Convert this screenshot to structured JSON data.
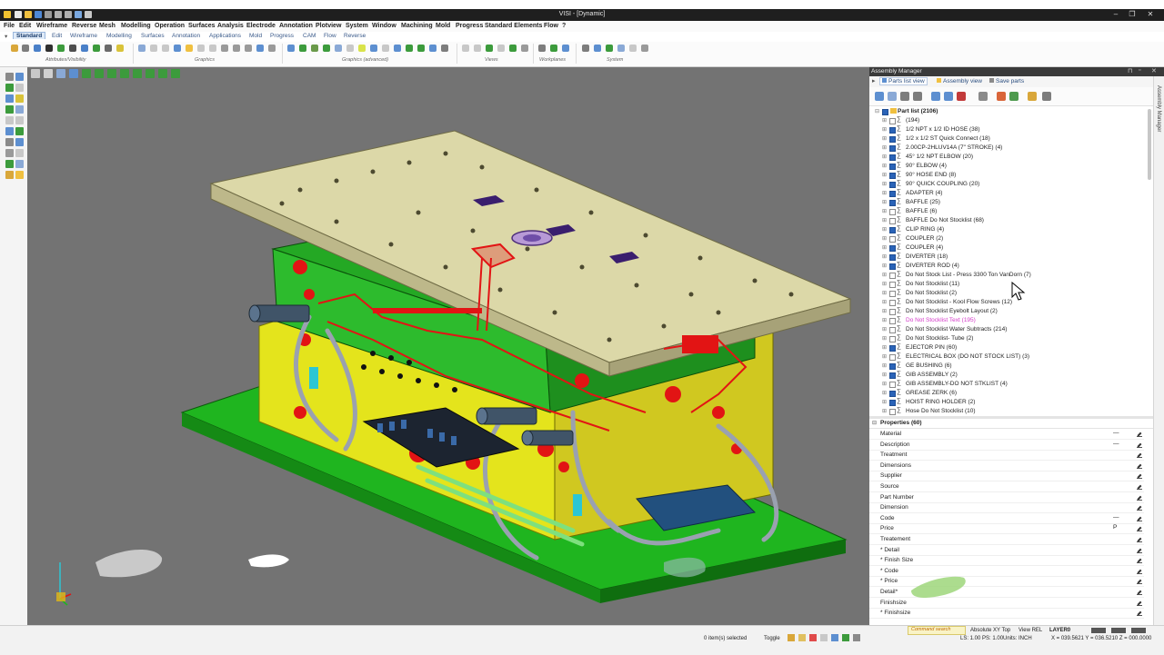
{
  "window": {
    "title": "VISI - [Dynamic]",
    "controls": [
      "–",
      "❐",
      "✕"
    ]
  },
  "menu": {
    "items": [
      "File",
      "Edit",
      "Wireframe",
      "Reverse",
      "Mesh",
      "Modelling",
      "Operation",
      "Surfaces",
      "Analysis",
      "Electrode",
      "Annotation",
      "Plotview",
      "System",
      "Window",
      "Machining",
      "Mold",
      "Progress",
      "Standard Elements",
      "Flow",
      "?"
    ]
  },
  "ribbon": {
    "tabs": [
      "Standard",
      "Edit",
      "Wireframe",
      "Modelling",
      "Surfaces",
      "Annotation",
      "Applications",
      "Mold",
      "Progress",
      "CAM",
      "Flow",
      "Reverse"
    ],
    "active_tab": "Standard",
    "groups": [
      "Attributes/Visibility",
      "Graphics",
      "Graphics (advanced)",
      "Views",
      "Workplanes",
      "System"
    ]
  },
  "assembly_manager": {
    "title": "Assembly Manager",
    "side_label": "Assembly Manager",
    "tabs": [
      "Parts list view",
      "Assembly view",
      "Save parts"
    ],
    "active_tab": "Parts list view",
    "tree_root": "Part list (2106)",
    "parts": [
      {
        "label": "(194)",
        "checked": false
      },
      {
        "label": "1/2 NPT x 1/2 ID HOSE (38)",
        "checked": true
      },
      {
        "label": "1/2 x 1/2 ST Quick Connect (18)",
        "checked": true
      },
      {
        "label": "2.00CP-2HLUV14A (7\" STROKE) (4)",
        "checked": true
      },
      {
        "label": "45° 1/2 NPT ELBOW (20)",
        "checked": true
      },
      {
        "label": "90° ELBOW (4)",
        "checked": true
      },
      {
        "label": "90° HOSE END (8)",
        "checked": true
      },
      {
        "label": "90° QUICK COUPLING (20)",
        "checked": true
      },
      {
        "label": "ADAPTER (4)",
        "checked": true
      },
      {
        "label": "BAFFLE (25)",
        "checked": true
      },
      {
        "label": "BAFFLE (6)",
        "checked": false
      },
      {
        "label": "BAFFLE Do Not Stocklist (68)",
        "checked": false
      },
      {
        "label": "CLIP RING (4)",
        "checked": true
      },
      {
        "label": "COUPLER (2)",
        "checked": false
      },
      {
        "label": "COUPLER (4)",
        "checked": true
      },
      {
        "label": "DIVERTER (18)",
        "checked": true
      },
      {
        "label": "DIVERTER ROD (4)",
        "checked": true
      },
      {
        "label": "Do Not Stock List - Press 3300 Ton VanDorn (7)",
        "checked": false
      },
      {
        "label": "Do Not Stocklist (11)",
        "checked": false
      },
      {
        "label": "Do Not Stocklist (2)",
        "checked": false
      },
      {
        "label": "Do Not Stocklist - Kool Flow Screws (12)",
        "checked": false
      },
      {
        "label": "Do Not Stocklist Eyebolt Layout (2)",
        "checked": false
      },
      {
        "label": "Do Not Stocklist Text (195)",
        "checked": false,
        "highlight": true
      },
      {
        "label": "Do Not Stocklist Water Subtracts (214)",
        "checked": false
      },
      {
        "label": "Do Not Stocklist- Tube (2)",
        "checked": false
      },
      {
        "label": "EJECTOR PIN (60)",
        "checked": true
      },
      {
        "label": "ELECTRICAL BOX (DO NOT STOCK LIST) (3)",
        "checked": false
      },
      {
        "label": "GE BUSHING (6)",
        "checked": true
      },
      {
        "label": "GIB ASSEMBLY (2)",
        "checked": true
      },
      {
        "label": "GIB ASSEMBLY-DO NOT STKLIST (4)",
        "checked": false
      },
      {
        "label": "GREASE ZERK (6)",
        "checked": true
      },
      {
        "label": "HOIST RING HOLDER (2)",
        "checked": true
      },
      {
        "label": "Hose Do Not Stocklist (10)",
        "checked": false
      }
    ],
    "properties_title": "Properties (60)",
    "properties": [
      {
        "label": "Material",
        "value": "—"
      },
      {
        "label": "Description",
        "value": "—"
      },
      {
        "label": "Treatment",
        "value": ""
      },
      {
        "label": "Dimensions",
        "value": ""
      },
      {
        "label": "Supplier",
        "value": ""
      },
      {
        "label": "Source",
        "value": ""
      },
      {
        "label": "Part Number",
        "value": ""
      },
      {
        "label": "Dimension",
        "value": ""
      },
      {
        "label": "Code",
        "value": "—"
      },
      {
        "label": "Price",
        "value": "P"
      },
      {
        "label": "Treatement",
        "value": ""
      },
      {
        "label": "* Detail",
        "value": ""
      },
      {
        "label": "* Finish Size",
        "value": ""
      },
      {
        "label": "* Code",
        "value": ""
      },
      {
        "label": "* Price",
        "value": ""
      },
      {
        "label": "Detail*",
        "value": ""
      },
      {
        "label": "Finishsize",
        "value": ""
      },
      {
        "label": "* Finishsize",
        "value": ""
      }
    ]
  },
  "status": {
    "command_search": "Command search",
    "selected": "0 item(s) selected",
    "toggle": "Toggle",
    "view": "Absolute XY Top",
    "view_rel": "View REL",
    "layer": "LAYER0",
    "ls": "LS: 1.00 PS: 1.00",
    "units": "Units: INCH",
    "coords": "X = 039.5621 Y = 036.5210 Z = 000.0000"
  },
  "colors": {
    "viewport_bg": "#737373",
    "plate_top": "#dcd8a8",
    "plate_green": "#1fb51f",
    "accent_red": "#e21414",
    "highlight_pink": "#d43ac9",
    "selected_tab": "#e0ebf8"
  }
}
